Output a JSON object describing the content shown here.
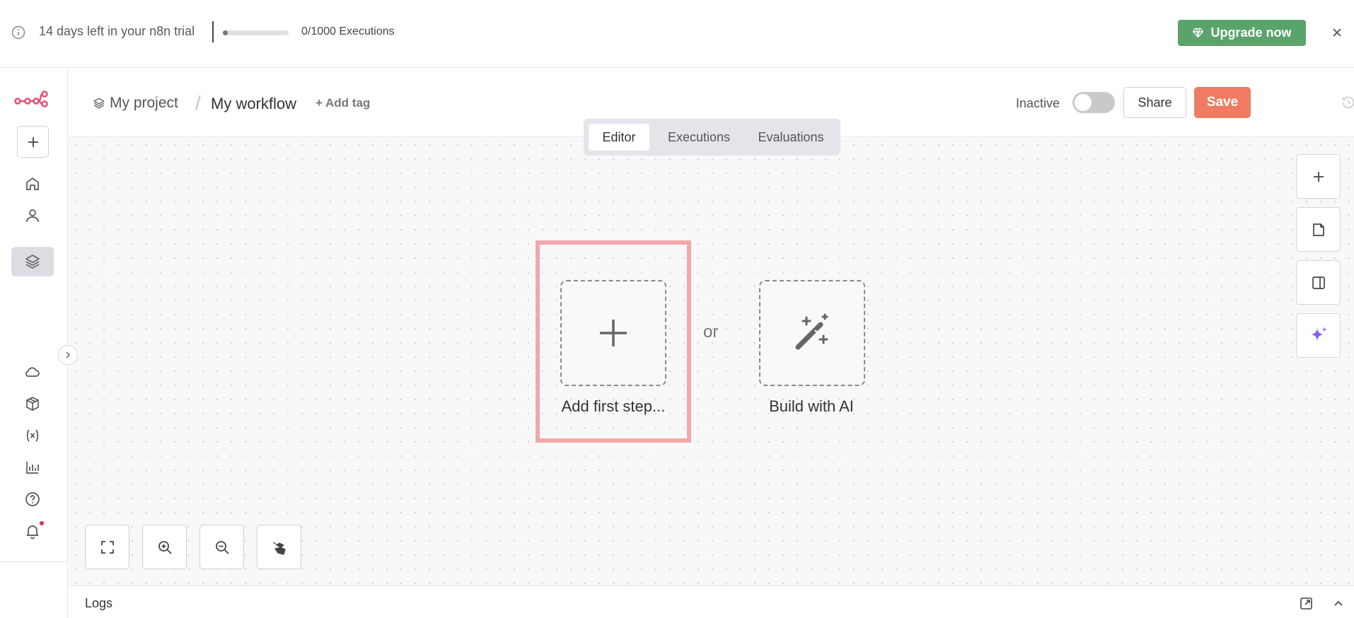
{
  "banner": {
    "trial_text": "14 days left in your n8n trial",
    "executions_text": "0/1000 Executions",
    "executions_used_fraction": 0.0,
    "upgrade_label": "Upgrade now",
    "upgrade_color": "#5aa36b",
    "icons": [
      "info-icon",
      "diamond-icon",
      "close-icon"
    ]
  },
  "sidebar": {
    "logo": "n8n-logo",
    "items": [
      {
        "name": "new",
        "icon": "plus-icon"
      },
      {
        "name": "overview",
        "icon": "home-icon"
      },
      {
        "name": "personal",
        "icon": "user-icon"
      },
      {
        "name": "project",
        "icon": "layers-icon",
        "active": true
      },
      {
        "name": "cloud",
        "icon": "cloud-icon"
      },
      {
        "name": "templates",
        "icon": "box-icon"
      },
      {
        "name": "variables",
        "icon": "variables-icon"
      },
      {
        "name": "insights",
        "icon": "bar-chart-icon"
      },
      {
        "name": "help",
        "icon": "help-icon"
      },
      {
        "name": "notifications",
        "icon": "bell-icon",
        "badge": true
      }
    ]
  },
  "header": {
    "project_label": "My project",
    "separator": "/",
    "workflow_name": "My workflow",
    "add_tag_label": "+ Add tag",
    "status_label": "Inactive",
    "active": false,
    "share_label": "Share",
    "save_label": "Save",
    "save_color": "#ef7b63"
  },
  "tabs": [
    {
      "label": "Editor",
      "active": true
    },
    {
      "label": "Executions",
      "active": false
    },
    {
      "label": "Evaluations",
      "active": false
    }
  ],
  "canvas": {
    "add_first_step_label": "Add first step...",
    "or_label": "or",
    "build_ai_label": "Build with AI",
    "highlight_color": "#f2a7ab",
    "right_tools": [
      "plus-icon",
      "sticky-note-icon",
      "panel-icon",
      "sparkle-icon"
    ],
    "bottom_tools": [
      "fit-view-icon",
      "zoom-in-icon",
      "zoom-out-icon",
      "tidy-up-icon"
    ]
  },
  "logs": {
    "label": "Logs"
  }
}
